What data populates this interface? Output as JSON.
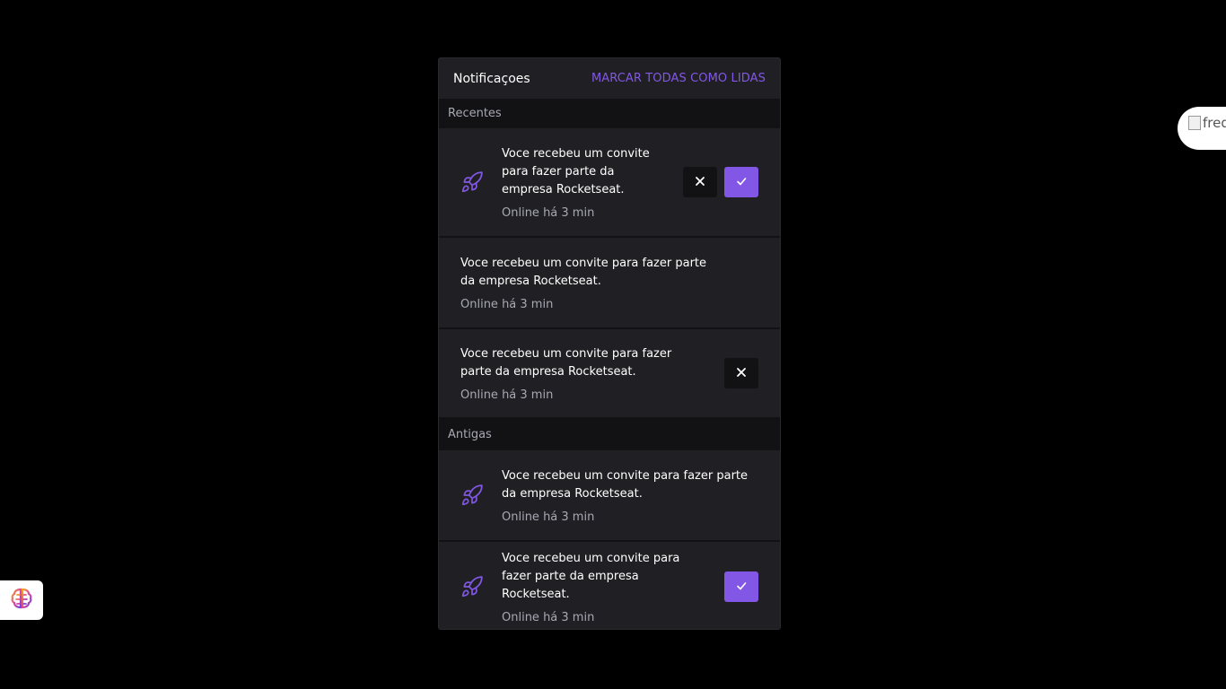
{
  "panel": {
    "title": "Notificaçoes",
    "mark_all_label": "MARCAR TODAS COMO LIDAS"
  },
  "sections": {
    "recent_label": "Recentes",
    "old_label": "Antigas"
  },
  "notifications": [
    {
      "text": "Voce recebeu um convite para fazer parte da empresa Rocketseat.",
      "time": "Online há 3 min",
      "icon": "rocket-icon",
      "actions": [
        "reject",
        "accept"
      ]
    },
    {
      "text": "Voce recebeu um convite para fazer parte da empresa Rocketseat.",
      "time": "Online há 3 min",
      "icon": "",
      "actions": []
    },
    {
      "text": "Voce recebeu um convite para fazer parte da empresa Rocketseat.",
      "time": "Online há 3 min",
      "icon": "",
      "actions": [
        "reject"
      ]
    },
    {
      "text": "Voce recebeu um convite para fazer parte da empresa Rocketseat.",
      "time": "Online há 3 min",
      "icon": "rocket-icon",
      "actions": []
    },
    {
      "text": "Voce recebeu um convite para fazer parte da empresa Rocketseat.",
      "time": "Online há 3 min",
      "icon": "rocket-icon",
      "actions": [
        "accept"
      ]
    }
  ],
  "floating": {
    "avatar_alt": "fred"
  },
  "colors": {
    "accent": "#8257e5",
    "panel_bg": "#202024",
    "section_bg": "#121214",
    "background": "#000000"
  }
}
